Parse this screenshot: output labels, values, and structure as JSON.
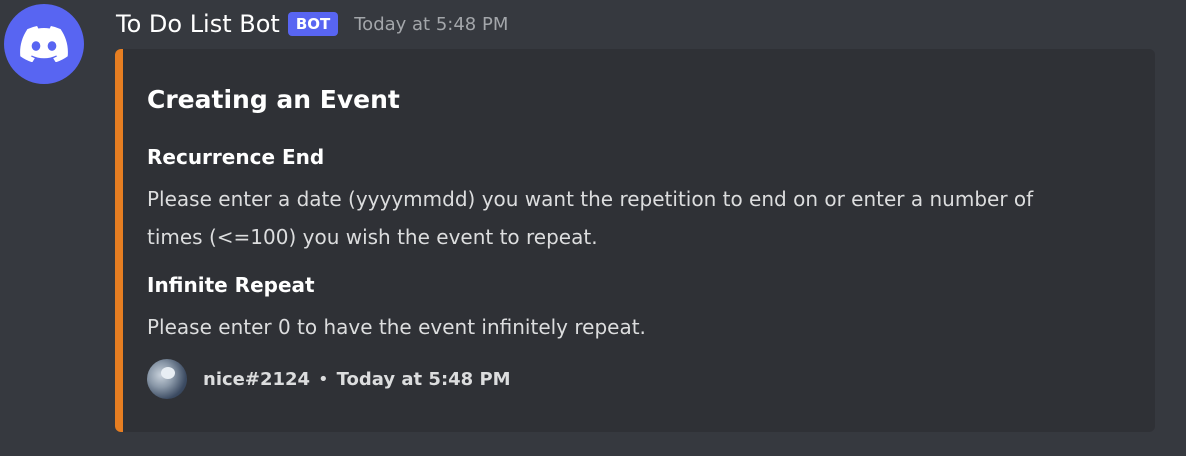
{
  "message": {
    "username": "To Do List Bot",
    "bot_tag": "BOT",
    "timestamp": "Today at 5:48 PM",
    "avatar_icon": "discord-logo-icon",
    "avatar_color": "#5865f2"
  },
  "embed": {
    "accent_color": "#e67e22",
    "title": "Creating an Event",
    "fields": [
      {
        "name": "Recurrence End",
        "value": "Please enter a date (yyyymmdd) you want the repetition to end on or enter a number of times (<=100) you wish the event to repeat."
      },
      {
        "name": "Infinite Repeat",
        "value": "Please enter 0 to have the event infinitely repeat."
      }
    ],
    "footer": {
      "author": "nice#2124",
      "separator": "•",
      "timestamp": "Today at 5:48 PM"
    }
  }
}
